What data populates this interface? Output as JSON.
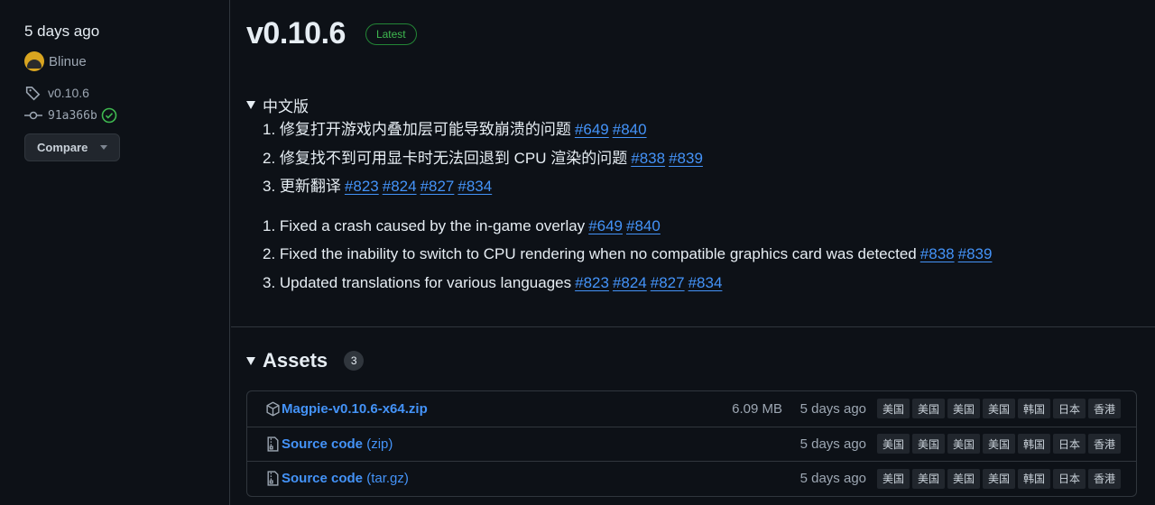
{
  "sidebar": {
    "date": "5 days ago",
    "author": "Blinue",
    "tag": "v0.10.6",
    "commit": "91a366b",
    "compare_label": "Compare"
  },
  "release": {
    "version": "v0.10.6",
    "badge": "Latest",
    "summary": "中文版",
    "cn_items": [
      {
        "text": "1. 修复打开游戏内叠加层可能导致崩溃的问题",
        "issues": [
          "#649",
          "#840"
        ]
      },
      {
        "text": "2. 修复找不到可用显卡时无法回退到 CPU 渲染的问题",
        "issues": [
          "#838",
          "#839"
        ]
      },
      {
        "text": "3. 更新翻译",
        "issues": [
          "#823",
          "#824",
          "#827",
          "#834"
        ]
      }
    ],
    "en_items": [
      {
        "text": "1. Fixed a crash caused by the in-game overlay",
        "issues": [
          "#649",
          "#840"
        ]
      },
      {
        "text": "2. Fixed the inability to switch to CPU rendering when no compatible graphics card was detected",
        "issues": [
          "#838",
          "#839"
        ]
      },
      {
        "text": "3. Updated translations for various languages",
        "issues": [
          "#823",
          "#824",
          "#827",
          "#834"
        ]
      }
    ]
  },
  "assets": {
    "title": "Assets",
    "count": "3",
    "items": [
      {
        "icon": "package-icon",
        "name": "Magpie-v0.10.6-x64.zip",
        "suffix": "",
        "size": "6.09 MB",
        "date": "5 days ago"
      },
      {
        "icon": "file-zip-icon",
        "name": "Source code",
        "suffix": " (zip)",
        "size": "",
        "date": "5 days ago"
      },
      {
        "icon": "file-zip-icon",
        "name": "Source code",
        "suffix": " (tar.gz)",
        "size": "",
        "date": "5 days ago"
      }
    ],
    "flags": [
      "美国",
      "美国",
      "美国",
      "美国",
      "韩国",
      "日本",
      "香港"
    ]
  },
  "colors": {
    "background": "#0d1117",
    "link": "#4493f8",
    "latest_green": "#3fb950",
    "border": "#30363d"
  }
}
